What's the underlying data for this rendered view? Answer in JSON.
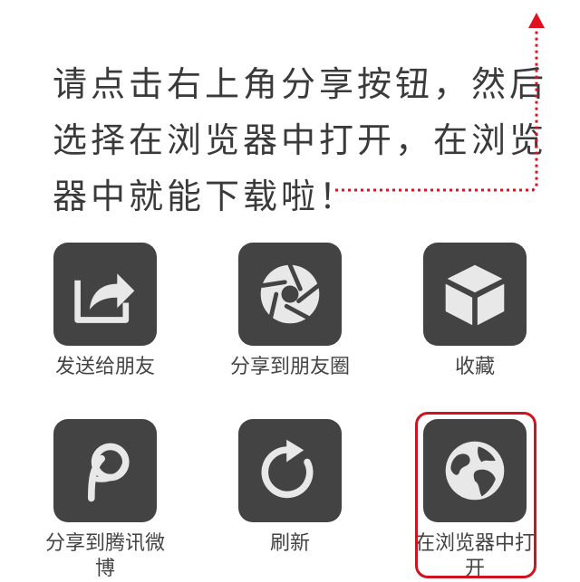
{
  "instructions": {
    "line1": "请点击右上角分享按钮，然后",
    "line2": "选择在浏览器中打开，在浏览",
    "line3": "器中就能下载啦！"
  },
  "share_menu": {
    "items": [
      {
        "label": "发送给朋友",
        "icon": "share-forward-icon"
      },
      {
        "label": "分享到朋友圈",
        "icon": "camera-aperture-icon"
      },
      {
        "label": "收藏",
        "icon": "cube-icon"
      },
      {
        "label": "分享到腾讯微博",
        "icon": "tencent-weibo-icon"
      },
      {
        "label": "刷新",
        "icon": "refresh-icon"
      },
      {
        "label": "在浏览器中打开",
        "icon": "globe-icon"
      }
    ]
  },
  "colors": {
    "tile_background": "#434343",
    "highlight_border": "#d0131f",
    "hint_arrow": "#e01020"
  }
}
